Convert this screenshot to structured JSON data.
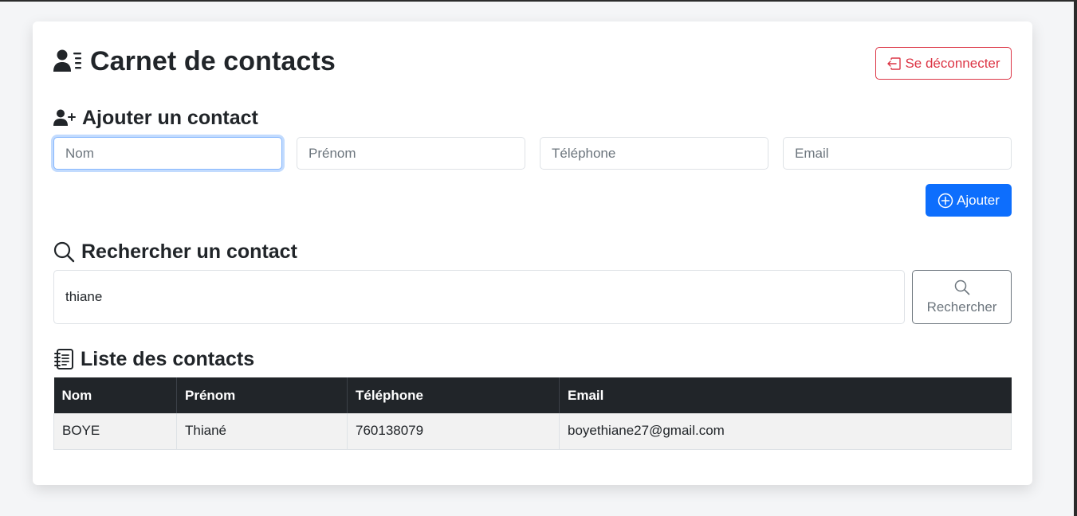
{
  "header": {
    "title": "Carnet de contacts",
    "logout_label": "Se déconnecter"
  },
  "add_section": {
    "title": "Ajouter un contact",
    "fields": {
      "nom_placeholder": "Nom",
      "prenom_placeholder": "Prénom",
      "telephone_placeholder": "Téléphone",
      "email_placeholder": "Email"
    },
    "add_label": "Ajouter"
  },
  "search_section": {
    "title": "Rechercher un contact",
    "value": "thiane",
    "button_label": "Rechercher"
  },
  "list_section": {
    "title": "Liste des contacts",
    "columns": [
      "Nom",
      "Prénom",
      "Téléphone",
      "Email"
    ],
    "rows": [
      [
        "BOYE",
        "Thiané",
        "760138079",
        "boyethiane27@gmail.com"
      ]
    ]
  },
  "colors": {
    "primary": "#0d6efd",
    "danger": "#dc3545",
    "dark": "#212529",
    "secondary": "#6c757d"
  },
  "icons": {
    "title": "person-lines-icon",
    "add_section": "person-plus-icon",
    "logout": "box-arrow-left-icon",
    "add_button": "plus-circle-icon",
    "search_section": "search-icon",
    "search_button": "search-icon",
    "list_section": "journal-text-icon"
  }
}
